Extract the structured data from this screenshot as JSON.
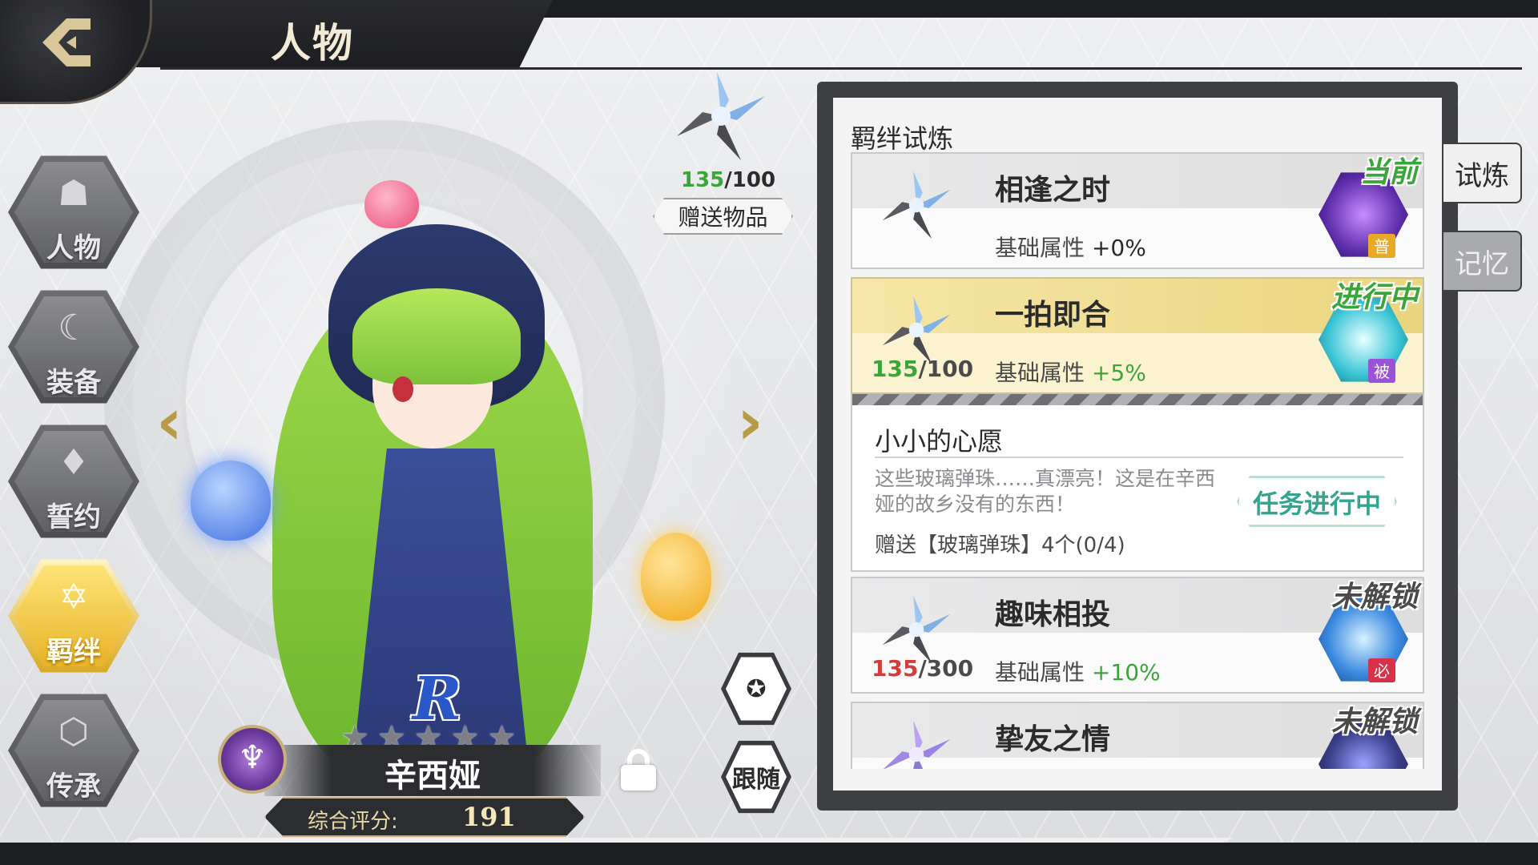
{
  "header": {
    "title": "人物"
  },
  "nav": {
    "items": [
      {
        "label": "人物",
        "icon": "character-icon",
        "active": false
      },
      {
        "label": "装备",
        "icon": "equipment-icon",
        "active": false
      },
      {
        "label": "誓约",
        "icon": "oath-icon",
        "active": false
      },
      {
        "label": "羁绊",
        "icon": "bond-icon",
        "active": true
      },
      {
        "label": "传承",
        "icon": "inheritance-icon",
        "active": false
      }
    ]
  },
  "character": {
    "rarity": "R",
    "name": "辛西娅",
    "stars": 5,
    "score_label": "综合评分:",
    "score_value": "191"
  },
  "gift": {
    "current": "135",
    "total": "/100",
    "button_label": "赠送物品"
  },
  "buttons": {
    "follow_label": "跟随",
    "favorite_icon": "star-icon",
    "lock_icon": "lock-icon"
  },
  "panel": {
    "title": "羁绊试炼",
    "tabs": [
      {
        "label": "试炼",
        "active": true
      },
      {
        "label": "记忆",
        "active": false
      }
    ],
    "trials": [
      {
        "name": "相逢之时",
        "stat_label": "基础属性",
        "stat_value": "+0%",
        "progress_cur": "",
        "progress_total": "",
        "status": "当前",
        "badge_tag": "普"
      },
      {
        "name": "一拍即合",
        "stat_label": "基础属性",
        "stat_value": "+5%",
        "progress_cur": "135",
        "progress_total": "/100",
        "status": "进行中",
        "badge_tag": "被"
      },
      {
        "name": "趣味相投",
        "stat_label": "基础属性",
        "stat_value": "+10%",
        "progress_cur": "135",
        "progress_total": "/300",
        "status": "未解锁",
        "badge_tag": "必"
      },
      {
        "name": "挚友之情",
        "stat_label": "",
        "stat_value": "",
        "progress_cur": "",
        "progress_total": "",
        "status": "未解锁",
        "badge_tag": ""
      }
    ],
    "detail": {
      "title": "小小的心愿",
      "description": "这些玻璃弹珠……真漂亮！这是在辛西娅的故乡没有的东西！",
      "task": "赠送【玻璃弹珠】4个(0/4)",
      "task_status": "任务进行中"
    }
  },
  "colors": {
    "accent_gold": "#e9b125",
    "progress_green": "#3aa63a",
    "locked_red": "#d43b3b",
    "task_teal": "#33a58e"
  }
}
